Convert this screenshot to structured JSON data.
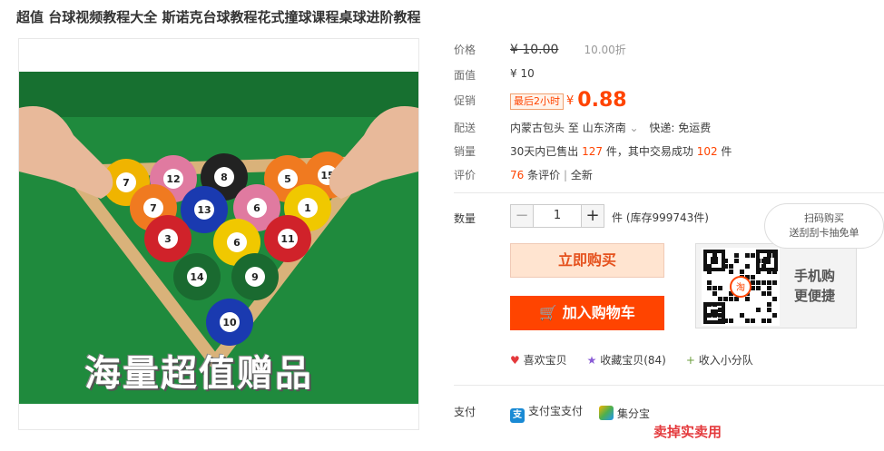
{
  "title": "超值 台球视频教程大全 斯诺克台球教程花式撞球课程桌球进阶教程",
  "product_image": {
    "overlay_text": "海量超值赠品",
    "ball_numbers": [
      "12",
      "8",
      "5",
      "15",
      "7",
      "13",
      "6",
      "1",
      "3",
      "6",
      "11",
      "14",
      "9",
      "10"
    ]
  },
  "price": {
    "label": "价格",
    "original": "¥ 10.00",
    "discount": "10.00折"
  },
  "face_value": {
    "label": "面值",
    "value": "¥ 10"
  },
  "promo": {
    "label": "促销",
    "badge": "最后2小时",
    "currency": "¥",
    "price": "0.88"
  },
  "delivery": {
    "label": "配送",
    "from": "内蒙古包头",
    "to_word": "至",
    "to": "山东济南",
    "shipping": "快递: 免运费"
  },
  "sales": {
    "label": "销量",
    "prefix": "30天内已售出",
    "sold": "127",
    "mid": "件，其中交易成功",
    "success": "102",
    "suffix": "件"
  },
  "reviews": {
    "label": "评价",
    "count": "76",
    "count_suffix": "条评价",
    "condition": "全新"
  },
  "quantity": {
    "label": "数量",
    "value": "1",
    "minus": "−",
    "plus": "+",
    "stock": "件 (库存999743件)"
  },
  "buttons": {
    "buy_now": "立即购买",
    "add_to_cart": "加入购物车"
  },
  "mobile": {
    "bubble_line1": "扫码购买",
    "bubble_line2": "送刮刮卡抽免单",
    "line1": "手机购",
    "line2": "更便捷"
  },
  "actions": {
    "like": "喜欢宝贝",
    "favorite": "收藏宝贝(84)",
    "join": "收入小分队"
  },
  "payment": {
    "label": "支付",
    "alipay": "支付宝支付",
    "jifen": "集分宝"
  },
  "footer_partial": "卖掉实卖用",
  "colors": {
    "accent": "#ff4400",
    "table_green": "#1c7a35"
  }
}
